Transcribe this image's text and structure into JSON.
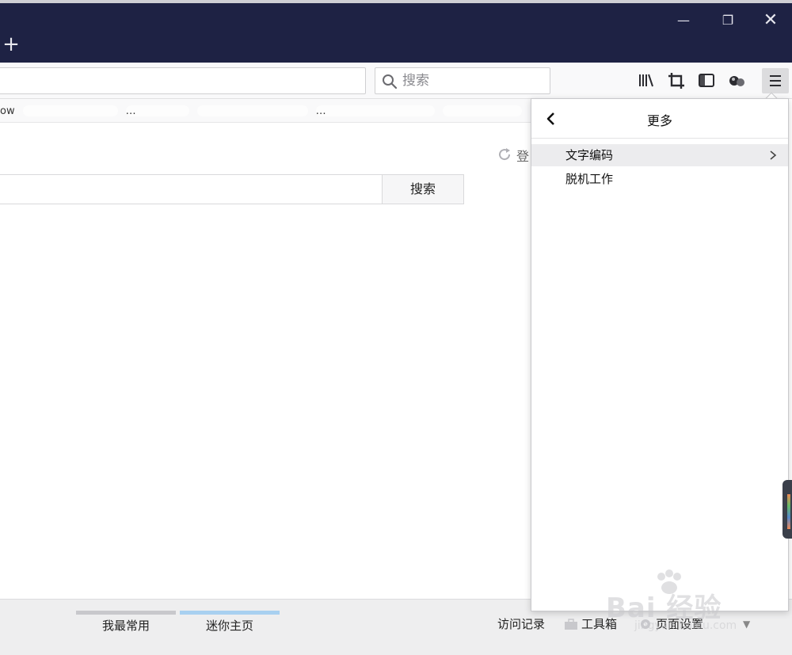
{
  "window": {
    "new_tab_glyph": "+",
    "minimize_glyph": "—",
    "restore_glyph": "❐",
    "close_glyph": "✕",
    "titlebar_color": "#1e2244"
  },
  "navbar": {
    "search_placeholder": "搜索",
    "icons": [
      "library-icon",
      "screenshot-crop-icon",
      "sidebar-icon",
      "extension-icon",
      "hamburger-menu-icon"
    ]
  },
  "bookmarks": {
    "items": [
      "ow",
      "",
      "…",
      "",
      "…",
      ""
    ]
  },
  "page": {
    "login_label": "登",
    "search_button": "搜索"
  },
  "statusbar": {
    "tabs": [
      {
        "label": "我最常用"
      },
      {
        "label": "迷你主页"
      }
    ],
    "history": "访问记录",
    "toolbox": "工具箱",
    "page_settings": "页面设置"
  },
  "panel": {
    "title": "更多",
    "items": [
      {
        "label": "文字编码",
        "has_submenu": true
      },
      {
        "label": "脱机工作",
        "has_submenu": false
      }
    ]
  },
  "watermark": {
    "brand": "Bai 经验",
    "url": "jingyan.baidu.com"
  }
}
